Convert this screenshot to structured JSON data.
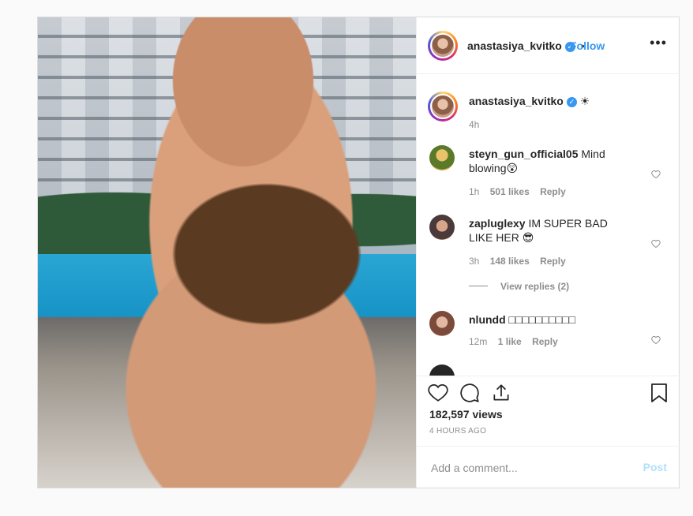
{
  "post": {
    "author": "anastasiya_kvitko",
    "follow_label": "Follow",
    "separator": "•",
    "more_label": "•••",
    "verified_glyph": "✓"
  },
  "caption": {
    "author": "anastasiya_kvitko",
    "text": "☀",
    "age": "4h"
  },
  "comments": [
    {
      "user": "steyn_gun_official05",
      "text": "Mind blowing😲",
      "age": "1h",
      "likes": "501 likes",
      "reply": "Reply"
    },
    {
      "user": "zapluglexy",
      "text": "IM SUPER BAD LIKE HER 😎",
      "age": "3h",
      "likes": "148 likes",
      "reply": "Reply",
      "view_replies": "View replies (2)"
    },
    {
      "user": "nlundd",
      "text": "□□□□□□□□□□",
      "age": "12m",
      "likes": "1 like",
      "reply": "Reply"
    }
  ],
  "stats": {
    "views": "182,597 views",
    "posted": "4 HOURS AGO"
  },
  "composer": {
    "placeholder": "Add a comment...",
    "post_label": "Post"
  },
  "colors": {
    "link_blue": "#3897f0",
    "muted": "#8e8e8e",
    "post_disabled": "#b2dffc"
  }
}
